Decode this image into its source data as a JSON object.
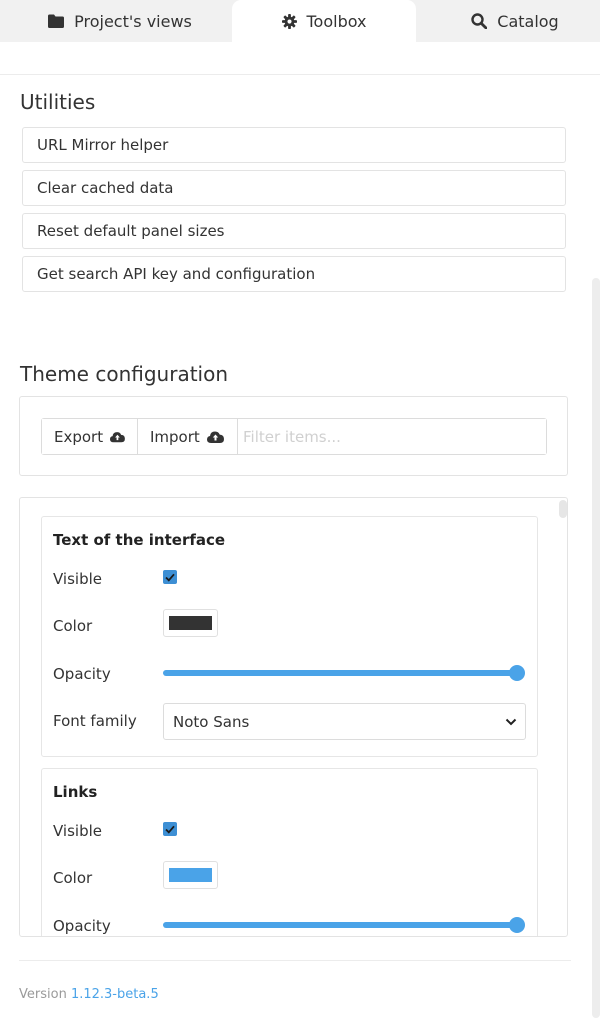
{
  "tabs": [
    {
      "label": "Project's views",
      "icon": "folder-icon",
      "active": false
    },
    {
      "label": "Toolbox",
      "icon": "gear-icon",
      "active": true
    },
    {
      "label": "Catalog",
      "icon": "search-icon",
      "active": false
    }
  ],
  "utilities": {
    "title": "Utilities",
    "items": [
      {
        "label": "URL Mirror helper"
      },
      {
        "label": "Clear cached data"
      },
      {
        "label": "Reset default panel sizes"
      },
      {
        "label": "Get search API key and configuration"
      }
    ]
  },
  "theme": {
    "title": "Theme configuration",
    "export_label": "Export",
    "import_label": "Import",
    "filter_placeholder": "Filter items...",
    "cards": [
      {
        "title": "Text of the interface",
        "visible_label": "Visible",
        "visible": true,
        "color_label": "Color",
        "color": "#333333",
        "opacity_label": "Opacity",
        "opacity": 1.0,
        "font_label": "Font family",
        "font_value": "Noto Sans"
      },
      {
        "title": "Links",
        "visible_label": "Visible",
        "visible": true,
        "color_label": "Color",
        "color": "#4aa3e8",
        "opacity_label": "Opacity",
        "opacity": 1.0
      }
    ]
  },
  "footer": {
    "version_label": "Version",
    "version_value": "1.12.3-beta.5"
  },
  "colors": {
    "accent": "#4aa3e8",
    "checkbox": "#3d8fd4",
    "tabbar_bg": "#f1f1f1"
  }
}
